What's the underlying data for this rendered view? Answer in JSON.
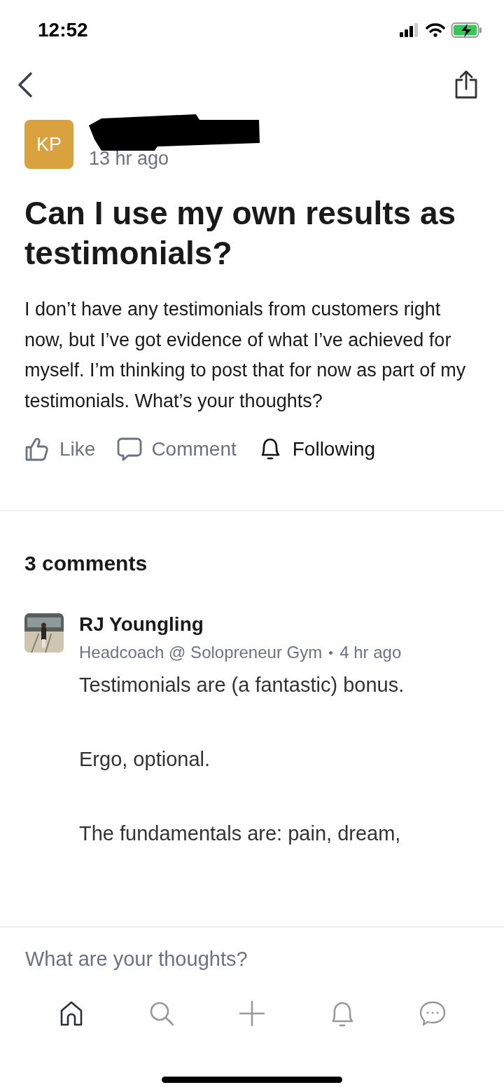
{
  "status_bar": {
    "time": "12:52"
  },
  "post": {
    "author": {
      "initials": "KP",
      "color": "#d9a23f",
      "redacted": true,
      "time": "13 hr ago"
    },
    "title": "Can I use my own results as testimonials?",
    "body": "I don’t have any testimonials from customers right now, but I’ve got evidence of what I’ve achieved for myself. I’m thinking to post that for now as part of my testimonials. What’s your thoughts?",
    "actions": [
      {
        "kind": "like",
        "label": "Like",
        "active": false
      },
      {
        "kind": "comment",
        "label": "Comment",
        "active": false
      },
      {
        "kind": "follow",
        "label": "Following",
        "active": true
      }
    ]
  },
  "comments_heading": "3 comments",
  "comments": [
    {
      "author": "RJ Youngling",
      "subtitle": "Headcoach @ Solopreneur Gym",
      "time": "4 hr ago",
      "paragraphs": [
        "Testimonials are (a fantastic) bonus.",
        "Ergo, optional.",
        "The fundamentals are: pain, dream,"
      ]
    }
  ],
  "reply_field": {
    "placeholder": "What are your thoughts?"
  },
  "tab_bar": [
    {
      "kind": "home",
      "selected": true
    },
    {
      "kind": "search",
      "selected": false
    },
    {
      "kind": "create",
      "selected": false
    },
    {
      "kind": "notifications",
      "selected": false
    },
    {
      "kind": "messages",
      "selected": false
    }
  ]
}
